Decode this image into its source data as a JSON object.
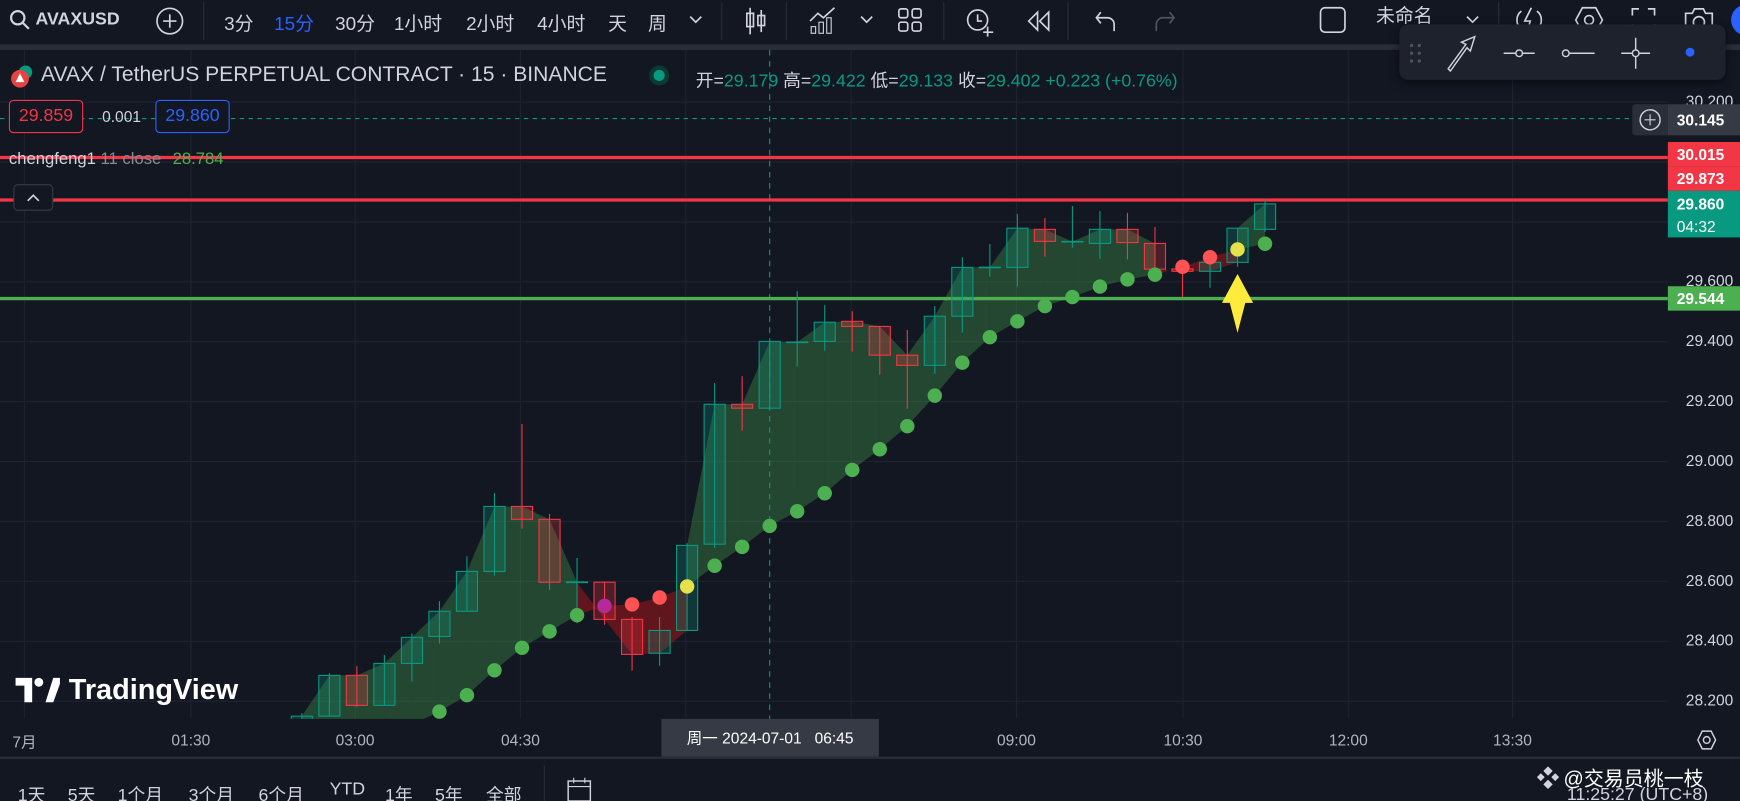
{
  "toolbar": {
    "symbol": "AVAXUSD",
    "intervals": [
      "3分",
      "15分",
      "30分",
      "1小时",
      "2小时",
      "4小时",
      "天",
      "周"
    ],
    "active_interval": "15分",
    "layout_name": "未命名",
    "accent": "#2962ff"
  },
  "legend": {
    "title": "AVAX / TetherUS PERPETUAL CONTRACT · 15 · BINANCE",
    "open_label": "开=",
    "open": "29.179",
    "high_label": "高=",
    "high": "29.422",
    "low_label": "低=",
    "low": "29.133",
    "close_label": "收=",
    "close": "29.402",
    "change": "+0.223 (+0.76%)",
    "sell_price": "29.859",
    "spread": "0.001",
    "buy_price": "29.860",
    "indicator_name": "chengfeng1",
    "indicator_params": "11 close",
    "indicator_value": "28.784"
  },
  "price_axis": {
    "ticks": [
      "30.200",
      "29.600",
      "29.400",
      "29.200",
      "29.000",
      "28.800",
      "28.600",
      "28.400",
      "28.200"
    ],
    "labels": {
      "crosshair": "30.145",
      "red_line_1": "30.015",
      "red_line_2": "29.873",
      "last_price": "29.860",
      "countdown": "04:32",
      "green_line": "29.544"
    }
  },
  "time_axis": {
    "labels": [
      "7月",
      "01:30",
      "03:00",
      "04:30",
      "09:00",
      "10:30",
      "12:00",
      "13:30"
    ],
    "crosshair_label": "周一 2024-07-01   06:45"
  },
  "bottom_bar": {
    "ranges": [
      "1天",
      "5天",
      "1个月",
      "3个月",
      "6个月",
      "YTD",
      "1年",
      "5年",
      "全部"
    ],
    "watermark": "@交易员桃一枝",
    "clock": "11:25:27 (UTC+8)"
  },
  "logo_text": "TradingView",
  "colors": {
    "up": "#089981",
    "down": "#f23645",
    "psar": "#4caf50",
    "line_red": "#f23645",
    "line_green": "#4caf50",
    "signal_yellow": "#ffeb3b"
  },
  "chart_data": {
    "type": "candlestick",
    "interval_minutes": 15,
    "ylim": [
      28.15,
      30.2
    ],
    "horizontal_lines": [
      {
        "price": 30.015,
        "color": "#f23645"
      },
      {
        "price": 29.873,
        "color": "#f23645"
      },
      {
        "price": 29.544,
        "color": "#4caf50"
      }
    ],
    "crosshair": {
      "time": "06:45",
      "price": 30.145
    },
    "signal_arrow": {
      "time": "11:00",
      "direction": "up"
    },
    "candles": [
      [
        "02:30",
        28.12,
        28.16,
        28.1,
        28.15
      ],
      [
        "02:45",
        28.15,
        28.293,
        28.15,
        28.286
      ],
      [
        "03:00",
        28.286,
        28.317,
        28.181,
        28.186
      ],
      [
        "03:15",
        28.186,
        28.354,
        28.186,
        28.326
      ],
      [
        "03:30",
        28.326,
        28.426,
        28.265,
        28.413
      ],
      [
        "03:45",
        28.416,
        28.534,
        28.392,
        28.5
      ],
      [
        "04:00",
        28.5,
        28.684,
        28.5,
        28.633
      ],
      [
        "04:15",
        28.633,
        28.895,
        28.619,
        28.85
      ],
      [
        "04:30",
        28.85,
        29.125,
        28.776,
        28.807
      ],
      [
        "04:45",
        28.807,
        28.825,
        28.572,
        28.597
      ],
      [
        "05:00",
        28.597,
        28.678,
        28.46,
        28.597
      ],
      [
        "05:15",
        28.597,
        28.6,
        28.455,
        28.473
      ],
      [
        "05:30",
        28.473,
        28.481,
        28.302,
        28.356
      ],
      [
        "05:45",
        28.36,
        28.481,
        28.318,
        28.436
      ],
      [
        "06:00",
        28.436,
        28.727,
        28.436,
        28.72
      ],
      [
        "06:15",
        28.724,
        29.262,
        28.712,
        29.191
      ],
      [
        "06:30",
        29.191,
        29.285,
        29.103,
        29.178
      ],
      [
        "06:45",
        29.178,
        29.401,
        29.17,
        29.401
      ],
      [
        "07:00",
        29.398,
        29.569,
        29.317,
        29.398
      ],
      [
        "07:15",
        29.401,
        29.522,
        29.37,
        29.465
      ],
      [
        "07:30",
        29.468,
        29.502,
        29.367,
        29.451
      ],
      [
        "07:45",
        29.451,
        29.451,
        29.29,
        29.355
      ],
      [
        "08:00",
        29.355,
        29.439,
        29.176,
        29.321
      ],
      [
        "08:15",
        29.321,
        29.519,
        29.293,
        29.485
      ],
      [
        "08:30",
        29.485,
        29.682,
        29.43,
        29.648
      ],
      [
        "08:45",
        29.648,
        29.726,
        29.617,
        29.648
      ],
      [
        "09:00",
        29.648,
        29.826,
        29.584,
        29.779
      ],
      [
        "09:15",
        29.775,
        29.813,
        29.684,
        29.735
      ],
      [
        "09:30",
        29.734,
        29.853,
        29.714,
        29.734
      ],
      [
        "09:45",
        29.728,
        29.836,
        29.677,
        29.775
      ],
      [
        "10:00",
        29.775,
        29.83,
        29.674,
        29.731
      ],
      [
        "10:15",
        29.728,
        29.783,
        29.62,
        29.642
      ],
      [
        "10:30",
        29.643,
        29.654,
        29.55,
        29.635
      ],
      [
        "10:45",
        29.635,
        29.7,
        29.58,
        29.665
      ],
      [
        "11:00",
        29.665,
        29.779,
        29.65,
        29.779
      ],
      [
        "11:15",
        29.775,
        29.875,
        29.767,
        29.86
      ]
    ],
    "psar": [
      null,
      null,
      null,
      null,
      null,
      28.165,
      28.22,
      28.303,
      28.378,
      28.433,
      28.487,
      28.518,
      28.523,
      28.546,
      28.583,
      28.652,
      28.715,
      28.785,
      28.834,
      28.894,
      28.972,
      29.041,
      29.118,
      29.22,
      29.33,
      29.415,
      29.468,
      29.519,
      29.549,
      29.584,
      29.608,
      29.624,
      29.65,
      29.682,
      29.708,
      29.727
    ],
    "psar_state": [
      null,
      null,
      null,
      null,
      null,
      "up",
      "up",
      "up",
      "up",
      "up",
      "up",
      "flip_down",
      "down",
      "down",
      "flip_up",
      "up",
      "up",
      "up",
      "up",
      "up",
      "up",
      "up",
      "up",
      "up",
      "up",
      "up",
      "up",
      "up",
      "up",
      "up",
      "up",
      "up",
      "down",
      "down",
      "flip_up",
      "up"
    ]
  }
}
